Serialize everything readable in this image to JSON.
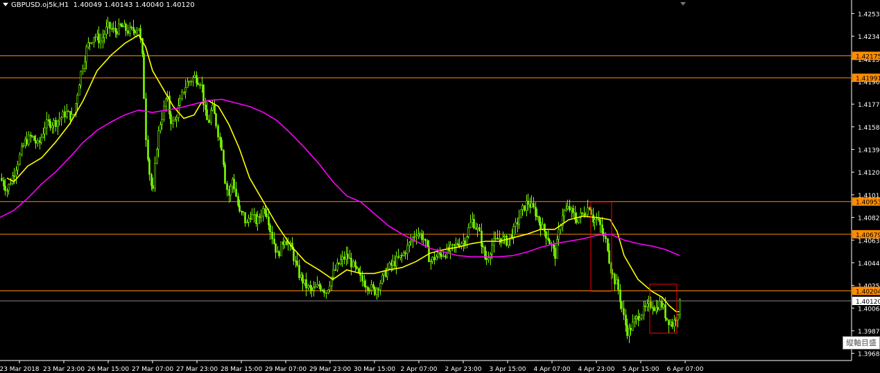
{
  "header": {
    "title": "GBPUSD.oj5k,H1",
    "ohlc": "1.40049 1.40143 1.40040 1.40120"
  },
  "axis_tooltip": "縦軸目盛",
  "colors": {
    "background": "#000000",
    "candle": "#7CFC00",
    "ma_fast": "#FFFF00",
    "ma_slow": "#FF00FF",
    "hline": "#FF8C00",
    "box": "#FF0000",
    "axis": "#FFFFFF"
  },
  "chart_data": {
    "type": "candlestick",
    "title": "GBPUSD.oj5k,H1",
    "ylim": [
      1.3962,
      1.4262
    ],
    "y_ticks": [
      "1.42530",
      "1.42340",
      "1.42150",
      "1.41960",
      "1.41770",
      "1.41580",
      "1.41390",
      "1.41200",
      "1.41010",
      "1.40820",
      "1.40630",
      "1.40440",
      "1.40250",
      "1.40060",
      "1.39870",
      "1.39680"
    ],
    "x_ticks": [
      "23 Mar 2018",
      "23 Mar 23:00",
      "26 Mar 15:00",
      "27 Mar 07:00",
      "27 Mar 23:00",
      "28 Mar 15:00",
      "29 Mar 07:00",
      "29 Mar 23:00",
      "30 Mar 15:00",
      "2 Apr 07:00",
      "2 Apr 23:00",
      "3 Apr 15:00",
      "4 Apr 07:00",
      "4 Apr 23:00",
      "5 Apr 15:00",
      "6 Apr 07:00"
    ],
    "horizontal_lines": [
      {
        "value": 1.42175,
        "label": "1.42175"
      },
      {
        "value": 1.41991,
        "label": "1.41991"
      },
      {
        "value": 1.40953,
        "label": "1.40953"
      },
      {
        "value": 1.40679,
        "label": "1.40679"
      },
      {
        "value": 1.40204,
        "label": "1.40204"
      }
    ],
    "current_price": {
      "value": 1.4012,
      "label": "1.40120"
    },
    "price_path": [
      [
        0,
        1.4115
      ],
      [
        10,
        1.4105
      ],
      [
        20,
        1.412
      ],
      [
        35,
        1.4145
      ],
      [
        45,
        1.415
      ],
      [
        55,
        1.4142
      ],
      [
        65,
        1.416
      ],
      [
        80,
        1.4162
      ],
      [
        95,
        1.417
      ],
      [
        105,
        1.4165
      ],
      [
        115,
        1.42
      ],
      [
        125,
        1.4225
      ],
      [
        135,
        1.4235
      ],
      [
        145,
        1.423
      ],
      [
        155,
        1.4242
      ],
      [
        165,
        1.4238
      ],
      [
        175,
        1.4242
      ],
      [
        185,
        1.4238
      ],
      [
        195,
        1.424
      ],
      [
        200,
        1.4242
      ],
      [
        205,
        1.4215
      ],
      [
        210,
        1.415
      ],
      [
        215,
        1.412
      ],
      [
        220,
        1.41
      ],
      [
        225,
        1.414
      ],
      [
        230,
        1.416
      ],
      [
        235,
        1.417
      ],
      [
        240,
        1.4185
      ],
      [
        245,
        1.4165
      ],
      [
        250,
        1.416
      ],
      [
        255,
        1.417
      ],
      [
        260,
        1.418
      ],
      [
        265,
        1.419
      ],
      [
        270,
        1.4195
      ],
      [
        280,
        1.42
      ],
      [
        290,
        1.4195
      ],
      [
        295,
        1.417
      ],
      [
        300,
        1.416
      ],
      [
        305,
        1.4175
      ],
      [
        310,
        1.4165
      ],
      [
        315,
        1.415
      ],
      [
        320,
        1.414
      ],
      [
        325,
        1.411
      ],
      [
        330,
        1.41
      ],
      [
        335,
        1.4115
      ],
      [
        340,
        1.41
      ],
      [
        345,
        1.4085
      ],
      [
        350,
        1.4085
      ],
      [
        355,
        1.4075
      ],
      [
        360,
        1.4085
      ],
      [
        370,
        1.4078
      ],
      [
        380,
        1.409
      ],
      [
        385,
        1.4085
      ],
      [
        390,
        1.407
      ],
      [
        395,
        1.406
      ],
      [
        400,
        1.405
      ],
      [
        410,
        1.4065
      ],
      [
        420,
        1.4055
      ],
      [
        430,
        1.4035
      ],
      [
        440,
        1.4025
      ],
      [
        450,
        1.402
      ],
      [
        460,
        1.4025
      ],
      [
        470,
        1.402
      ],
      [
        480,
        1.4035
      ],
      [
        490,
        1.4045
      ],
      [
        500,
        1.405
      ],
      [
        505,
        1.4045
      ],
      [
        510,
        1.404
      ],
      [
        520,
        1.403
      ],
      [
        530,
        1.4025
      ],
      [
        540,
        1.402
      ],
      [
        550,
        1.403
      ],
      [
        560,
        1.404
      ],
      [
        570,
        1.4045
      ],
      [
        580,
        1.405
      ],
      [
        590,
        1.406
      ],
      [
        600,
        1.407
      ],
      [
        610,
        1.4065
      ],
      [
        620,
        1.4045
      ],
      [
        630,
        1.405
      ],
      [
        640,
        1.4052
      ],
      [
        650,
        1.4055
      ],
      [
        660,
        1.406
      ],
      [
        670,
        1.4063
      ],
      [
        680,
        1.408
      ],
      [
        690,
        1.407
      ],
      [
        700,
        1.4045
      ],
      [
        710,
        1.406
      ],
      [
        720,
        1.4065
      ],
      [
        730,
        1.4062
      ],
      [
        740,
        1.407
      ],
      [
        750,
        1.4085
      ],
      [
        760,
        1.4095
      ],
      [
        770,
        1.4088
      ],
      [
        780,
        1.4075
      ],
      [
        790,
        1.4065
      ],
      [
        800,
        1.405
      ],
      [
        810,
        1.4085
      ],
      [
        820,
        1.409
      ],
      [
        830,
        1.408
      ],
      [
        840,
        1.4085
      ],
      [
        850,
        1.4092
      ],
      [
        855,
        1.408
      ],
      [
        860,
        1.408
      ],
      [
        865,
        1.4075
      ],
      [
        870,
        1.4065
      ],
      [
        875,
        1.406
      ],
      [
        880,
        1.404
      ],
      [
        885,
        1.403
      ],
      [
        890,
        1.4025
      ],
      [
        895,
        1.401
      ],
      [
        900,
        1.3995
      ],
      [
        905,
        1.3985
      ],
      [
        910,
        1.399
      ],
      [
        915,
        1.3995
      ],
      [
        920,
        1.4
      ],
      [
        930,
        1.4005
      ],
      [
        940,
        1.401
      ],
      [
        945,
        1.4005
      ],
      [
        950,
        1.401
      ],
      [
        955,
        1.4008
      ],
      [
        960,
        1.3998
      ],
      [
        965,
        1.3995
      ],
      [
        970,
        1.3992
      ],
      [
        975,
        1.4
      ],
      [
        980,
        1.401
      ]
    ],
    "series": [
      {
        "name": "MA fast",
        "color": "#FFFF00",
        "points": [
          [
            10,
            1.4115
          ],
          [
            20,
            1.4112
          ],
          [
            40,
            1.4125
          ],
          [
            60,
            1.4132
          ],
          [
            80,
            1.4145
          ],
          [
            100,
            1.416
          ],
          [
            120,
            1.418
          ],
          [
            140,
            1.4205
          ],
          [
            160,
            1.4218
          ],
          [
            180,
            1.4228
          ],
          [
            200,
            1.4235
          ],
          [
            210,
            1.4225
          ],
          [
            220,
            1.4205
          ],
          [
            235,
            1.419
          ],
          [
            250,
            1.4175
          ],
          [
            265,
            1.4165
          ],
          [
            280,
            1.4168
          ],
          [
            290,
            1.4178
          ],
          [
            300,
            1.418
          ],
          [
            315,
            1.4175
          ],
          [
            330,
            1.416
          ],
          [
            345,
            1.414
          ],
          [
            360,
            1.4115
          ],
          [
            380,
            1.4095
          ],
          [
            400,
            1.4075
          ],
          [
            420,
            1.4058
          ],
          [
            440,
            1.4045
          ],
          [
            460,
            1.4038
          ],
          [
            480,
            1.403
          ],
          [
            500,
            1.4038
          ],
          [
            520,
            1.4035
          ],
          [
            540,
            1.4035
          ],
          [
            560,
            1.4038
          ],
          [
            580,
            1.404
          ],
          [
            600,
            1.4045
          ],
          [
            620,
            1.4052
          ],
          [
            640,
            1.4055
          ],
          [
            660,
            1.4057
          ],
          [
            680,
            1.406
          ],
          [
            700,
            1.4062
          ],
          [
            720,
            1.4062
          ],
          [
            740,
            1.4065
          ],
          [
            760,
            1.4068
          ],
          [
            780,
            1.4072
          ],
          [
            800,
            1.4072
          ],
          [
            820,
            1.408
          ],
          [
            840,
            1.4083
          ],
          [
            860,
            1.4082
          ],
          [
            880,
            1.408
          ],
          [
            890,
            1.407
          ],
          [
            900,
            1.405
          ],
          [
            920,
            1.403
          ],
          [
            940,
            1.402
          ],
          [
            955,
            1.4015
          ],
          [
            965,
            1.4008
          ],
          [
            975,
            1.4003
          ],
          [
            980,
            1.4003
          ]
        ]
      },
      {
        "name": "MA slow",
        "color": "#FF00FF",
        "points": [
          [
            0,
            1.4082
          ],
          [
            20,
            1.4088
          ],
          [
            40,
            1.4098
          ],
          [
            60,
            1.411
          ],
          [
            80,
            1.412
          ],
          [
            100,
            1.4132
          ],
          [
            120,
            1.4145
          ],
          [
            140,
            1.4155
          ],
          [
            160,
            1.4162
          ],
          [
            180,
            1.4168
          ],
          [
            200,
            1.4172
          ],
          [
            220,
            1.417
          ],
          [
            240,
            1.4172
          ],
          [
            260,
            1.4174
          ],
          [
            280,
            1.4177
          ],
          [
            300,
            1.418
          ],
          [
            320,
            1.4181
          ],
          [
            340,
            1.4178
          ],
          [
            360,
            1.4175
          ],
          [
            380,
            1.417
          ],
          [
            400,
            1.4163
          ],
          [
            420,
            1.4152
          ],
          [
            440,
            1.414
          ],
          [
            460,
            1.4127
          ],
          [
            480,
            1.4112
          ],
          [
            500,
            1.41
          ],
          [
            520,
            1.4095
          ],
          [
            540,
            1.4085
          ],
          [
            560,
            1.4075
          ],
          [
            580,
            1.4068
          ],
          [
            600,
            1.4062
          ],
          [
            620,
            1.4056
          ],
          [
            640,
            1.4053
          ],
          [
            660,
            1.405
          ],
          [
            680,
            1.4049
          ],
          [
            700,
            1.4049
          ],
          [
            720,
            1.4049
          ],
          [
            740,
            1.405
          ],
          [
            760,
            1.4053
          ],
          [
            780,
            1.4057
          ],
          [
            800,
            1.406
          ],
          [
            820,
            1.4062
          ],
          [
            840,
            1.4064
          ],
          [
            860,
            1.4067
          ],
          [
            880,
            1.4068
          ],
          [
            900,
            1.4063
          ],
          [
            920,
            1.406
          ],
          [
            940,
            1.4058
          ],
          [
            960,
            1.4055
          ],
          [
            980,
            1.405
          ]
        ]
      }
    ],
    "boxes": [
      {
        "x0": 852,
        "x1": 882,
        "y0": 1.4095,
        "y1": 1.402
      },
      {
        "x0": 937,
        "x1": 976,
        "y0": 1.4026,
        "y1": 1.3985
      }
    ]
  }
}
